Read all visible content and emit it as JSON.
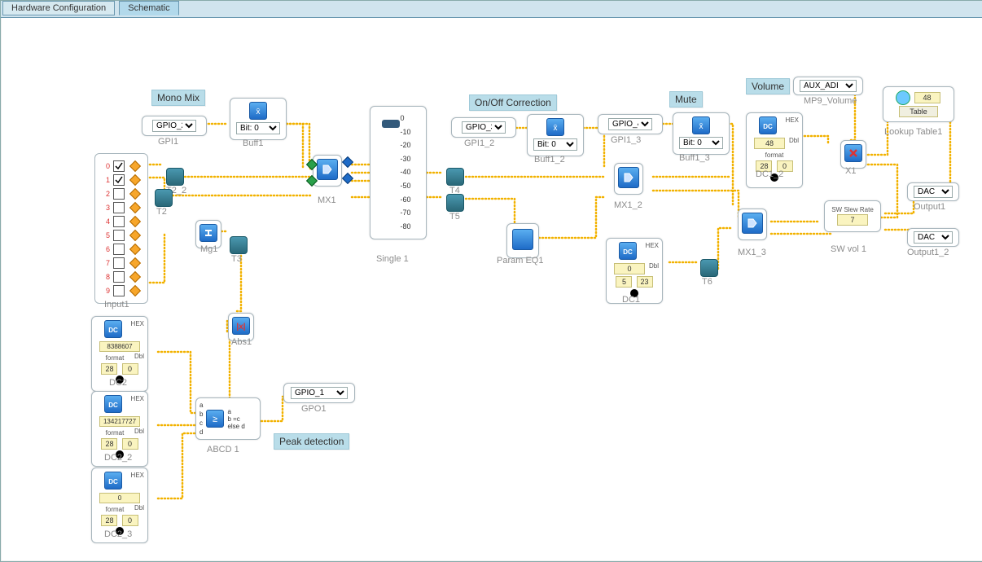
{
  "tabs": {
    "hw": "Hardware Configuration",
    "sch": "Schematic"
  },
  "groups": {
    "mono": "Mono Mix",
    "onoff": "On/Off Correction",
    "mute": "Mute",
    "volume": "Volume",
    "peak": "Peak detection"
  },
  "blocks": {
    "input1": {
      "name": "Input1",
      "rows": [
        0,
        1,
        2,
        3,
        4,
        5,
        6,
        7,
        8,
        9
      ],
      "checked": [
        0,
        1
      ]
    },
    "gpi1": {
      "name": "GPI1",
      "sel": "GPIO_2"
    },
    "buff1": {
      "name": "Buff1",
      "sel": "Bit: 0"
    },
    "t2_2": {
      "name": "T2_2"
    },
    "t2": {
      "name": "T2"
    },
    "mg1": {
      "name": "Mg1"
    },
    "t3": {
      "name": "T3"
    },
    "mx1": {
      "name": "MX1"
    },
    "single1": {
      "name": "Single 1",
      "ticks": [
        0,
        -10,
        -20,
        -30,
        -40,
        -50,
        -60,
        -70,
        -80
      ]
    },
    "gpi1_2": {
      "name": "GPI1_2",
      "sel": "GPIO_3"
    },
    "buff1_2": {
      "name": "Buff1_2",
      "sel": "Bit: 0"
    },
    "t4": {
      "name": "T4"
    },
    "t5": {
      "name": "T5"
    },
    "paramEQ": {
      "name": "Param EQ1"
    },
    "mx1_2": {
      "name": "MX1_2"
    },
    "gpi1_3": {
      "name": "GPI1_3",
      "sel": "GPIO_4"
    },
    "buff1_3": {
      "name": "Buff1_3",
      "sel": "Bit: 0"
    },
    "t6": {
      "name": "T6"
    },
    "dc1": {
      "name": "DC1",
      "val": "0",
      "fmt1": "5",
      "fmt2": "23",
      "hex": "HEX",
      "dbl": "Dbl"
    },
    "dc1_2": {
      "name": "DC1_2",
      "val": "48",
      "fmt_lbl": "format",
      "fmt1": "28",
      "fmt2": "0",
      "hex": "HEX",
      "dbl": "Dbl"
    },
    "mx1_3": {
      "name": "MX1_3"
    },
    "x1": {
      "name": "X1"
    },
    "mp9": {
      "sel": "AUX_ADI",
      "name": "MP9_Volume"
    },
    "lookup": {
      "name": "Lookup Table1",
      "btn": "Table",
      "val": "48"
    },
    "swvol": {
      "name": "SW vol 1",
      "t": "SW Slew Rate",
      "val": "7"
    },
    "output1": {
      "name": "Output1",
      "sel": "DAC"
    },
    "output1_2": {
      "name": "Output1_2",
      "sel": "DAC"
    },
    "dc2": {
      "name": "DC2",
      "val": "8388607",
      "fmt_lbl": "format",
      "fmt1": "28",
      "fmt2": "0",
      "hex": "HEX",
      "dbl": "Dbl"
    },
    "dc2_2": {
      "name": "DC2_2",
      "val": "134217727",
      "fmt_lbl": "format",
      "fmt1": "28",
      "fmt2": "0",
      "hex": "HEX",
      "dbl": "Dbl"
    },
    "dc2_3": {
      "name": "DC2_3",
      "val": "0",
      "fmt_lbl": "format",
      "fmt1": "28",
      "fmt2": "0",
      "hex": "HEX",
      "dbl": "Dbl"
    },
    "abs1": {
      "name": "Abs1"
    },
    "abcd1": {
      "name": "ABCD 1",
      "in": [
        "a",
        "b",
        "c",
        "d"
      ],
      "cond1": "a",
      "cond2": "b =c",
      "cond3": "else d"
    },
    "gpo1": {
      "name": "GPO1",
      "sel": "GPIO_1"
    }
  }
}
